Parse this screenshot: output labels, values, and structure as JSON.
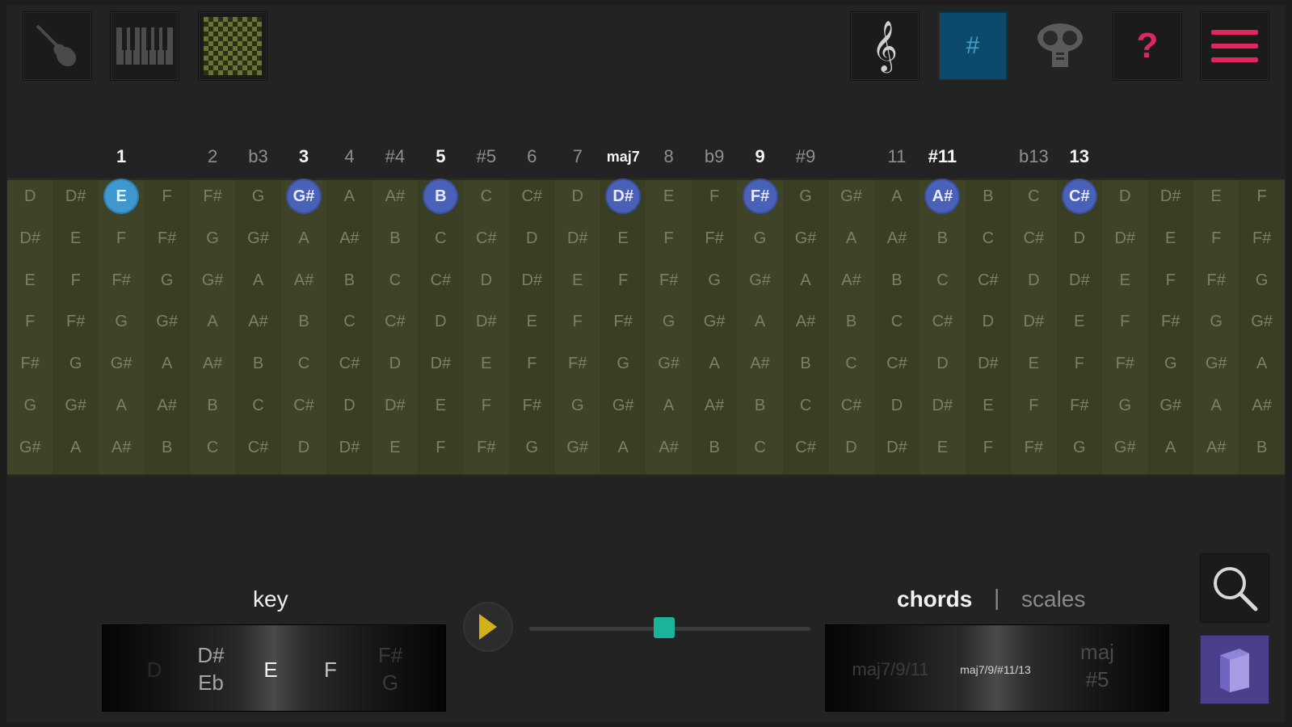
{
  "toolbar": {
    "left_buttons": [
      "guitar-icon",
      "piano-icon",
      "grid-icon"
    ],
    "right_buttons": [
      "treble-clef-icon",
      "sharp-icon",
      "ukulele-icon",
      "help-icon",
      "menu-icon"
    ],
    "sharp_label": "#",
    "help_label": "?",
    "accent_active": "#0b4a6a",
    "menu_color": "#e0265f",
    "help_color": "#e0265f"
  },
  "intervals": [
    {
      "label": "1",
      "col": 2,
      "bold": true
    },
    {
      "label": "2",
      "col": 4,
      "bold": false
    },
    {
      "label": "b3",
      "col": 5,
      "bold": false
    },
    {
      "label": "3",
      "col": 6,
      "bold": true
    },
    {
      "label": "4",
      "col": 7,
      "bold": false
    },
    {
      "label": "#4",
      "col": 8,
      "bold": false
    },
    {
      "label": "5",
      "col": 9,
      "bold": true
    },
    {
      "label": "#5",
      "col": 10,
      "bold": false
    },
    {
      "label": "6",
      "col": 11,
      "bold": false
    },
    {
      "label": "7",
      "col": 12,
      "bold": false
    },
    {
      "label": "maj7",
      "col": 13,
      "bold": true
    },
    {
      "label": "8",
      "col": 14,
      "bold": false
    },
    {
      "label": "b9",
      "col": 15,
      "bold": false
    },
    {
      "label": "9",
      "col": 16,
      "bold": true
    },
    {
      "label": "#9",
      "col": 17,
      "bold": false
    },
    {
      "label": "11",
      "col": 19,
      "bold": false
    },
    {
      "label": "#11",
      "col": 20,
      "bold": true
    },
    {
      "label": "b13",
      "col": 22,
      "bold": false
    },
    {
      "label": "13",
      "col": 23,
      "bold": true
    }
  ],
  "fretboard": {
    "rows": [
      [
        "D",
        "D#",
        "E",
        "F",
        "F#",
        "G",
        "G#",
        "A",
        "A#",
        "B",
        "C",
        "C#",
        "D",
        "D#",
        "E",
        "F",
        "F#",
        "G",
        "G#",
        "A",
        "A#",
        "B",
        "C",
        "C#",
        "D",
        "D#",
        "E",
        "F"
      ],
      [
        "D#",
        "E",
        "F",
        "F#",
        "G",
        "G#",
        "A",
        "A#",
        "B",
        "C",
        "C#",
        "D",
        "D#",
        "E",
        "F",
        "F#",
        "G",
        "G#",
        "A",
        "A#",
        "B",
        "C",
        "C#",
        "D",
        "D#",
        "E",
        "F",
        "F#"
      ],
      [
        "E",
        "F",
        "F#",
        "G",
        "G#",
        "A",
        "A#",
        "B",
        "C",
        "C#",
        "D",
        "D#",
        "E",
        "F",
        "F#",
        "G",
        "G#",
        "A",
        "A#",
        "B",
        "C",
        "C#",
        "D",
        "D#",
        "E",
        "F",
        "F#",
        "G"
      ],
      [
        "F",
        "F#",
        "G",
        "G#",
        "A",
        "A#",
        "B",
        "C",
        "C#",
        "D",
        "D#",
        "E",
        "F",
        "F#",
        "G",
        "G#",
        "A",
        "A#",
        "B",
        "C",
        "C#",
        "D",
        "D#",
        "E",
        "F",
        "F#",
        "G",
        "G#"
      ],
      [
        "F#",
        "G",
        "G#",
        "A",
        "A#",
        "B",
        "C",
        "C#",
        "D",
        "D#",
        "E",
        "F",
        "F#",
        "G",
        "G#",
        "A",
        "A#",
        "B",
        "C",
        "C#",
        "D",
        "D#",
        "E",
        "F",
        "F#",
        "G",
        "G#",
        "A"
      ],
      [
        "G",
        "G#",
        "A",
        "A#",
        "B",
        "C",
        "C#",
        "D",
        "D#",
        "E",
        "F",
        "F#",
        "G",
        "G#",
        "A",
        "A#",
        "B",
        "C",
        "C#",
        "D",
        "D#",
        "E",
        "F",
        "F#",
        "G",
        "G#",
        "A",
        "A#"
      ],
      [
        "G#",
        "A",
        "A#",
        "B",
        "C",
        "C#",
        "D",
        "D#",
        "E",
        "F",
        "F#",
        "G",
        "G#",
        "A",
        "A#",
        "B",
        "C",
        "C#",
        "D",
        "D#",
        "E",
        "F",
        "F#",
        "G",
        "G#",
        "A",
        "A#",
        "B"
      ]
    ],
    "highlighted_cols": [
      6,
      9,
      13,
      16,
      20,
      23
    ],
    "root_col": 2,
    "highlight_color": "#4a61b8",
    "root_color": "#3f97cf"
  },
  "key": {
    "title": "key",
    "items": [
      "D",
      "D#\nEb",
      "E",
      "F",
      "F#\nG"
    ]
  },
  "tempo_slider": {
    "value": 0.48
  },
  "chords": {
    "tab_chords": "chords",
    "separator": "|",
    "tab_scales": "scales",
    "items": [
      "maj7/9/11",
      "maj7/9/#11/13",
      "maj\n#5"
    ]
  },
  "side_buttons": [
    "search-icon",
    "book-icon"
  ]
}
